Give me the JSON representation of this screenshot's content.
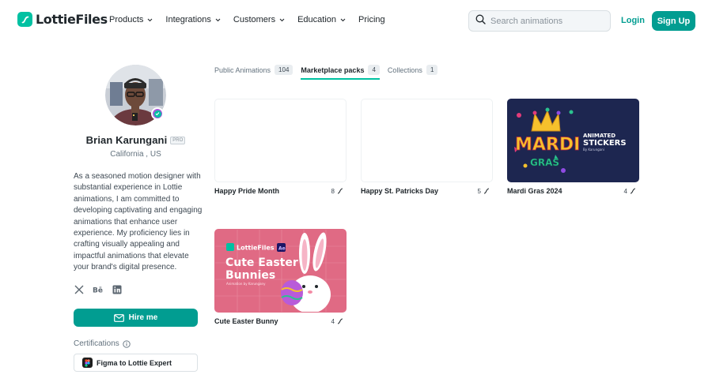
{
  "header": {
    "logo_text": "LottieFiles",
    "nav": [
      {
        "label": "Products",
        "has_dropdown": true
      },
      {
        "label": "Integrations",
        "has_dropdown": true
      },
      {
        "label": "Customers",
        "has_dropdown": true
      },
      {
        "label": "Education",
        "has_dropdown": true
      },
      {
        "label": "Pricing",
        "has_dropdown": false
      }
    ],
    "search_placeholder": "Search animations",
    "login_label": "Login",
    "signup_label": "Sign Up"
  },
  "profile": {
    "name": "Brian Karungani",
    "badge": "PRO",
    "location": "California , US",
    "bio": "As a seasoned motion designer with substantial experience in Lottie animations, I am committed to developing captivating and engaging animations that enhance user experience. My proficiency lies in crafting visually appealing and impactful animations that elevate your brand's digital presence.",
    "socials": [
      "x-icon",
      "behance-icon",
      "linkedin-icon"
    ],
    "hire_label": "Hire me",
    "certifications_label": "Certifications",
    "certifications": [
      {
        "label": "Figma to Lottie Expert"
      }
    ]
  },
  "tabs": [
    {
      "label": "Public Animations",
      "count": "104",
      "active": false
    },
    {
      "label": "Marketplace packs",
      "count": "4",
      "active": true
    },
    {
      "label": "Collections",
      "count": "1",
      "active": false
    }
  ],
  "packs": [
    {
      "title": "Happy Pride Month",
      "count": "8"
    },
    {
      "title": "Happy St. Patricks Day",
      "count": "5"
    },
    {
      "title": "Mardi Gras 2024",
      "count": "4",
      "thumb": {
        "line1": "MARDI",
        "line2": "GRAS",
        "tag1": "ANIMATED",
        "tag2": "STICKERS",
        "by": "By Karungani"
      }
    },
    {
      "title": "Cute Easter Bunny",
      "count": "4",
      "thumb": {
        "brand": "LottieFiles",
        "app": "Ae",
        "line1": "Cute Easter",
        "line2": "Bunnies",
        "by": "Animation by Karungany"
      }
    }
  ],
  "colors": {
    "accent": "#019d91",
    "brand": "#00c1a2",
    "text": "#20272c",
    "mardi_bg": "#1d2650",
    "easter_bg": "#e06a84"
  }
}
